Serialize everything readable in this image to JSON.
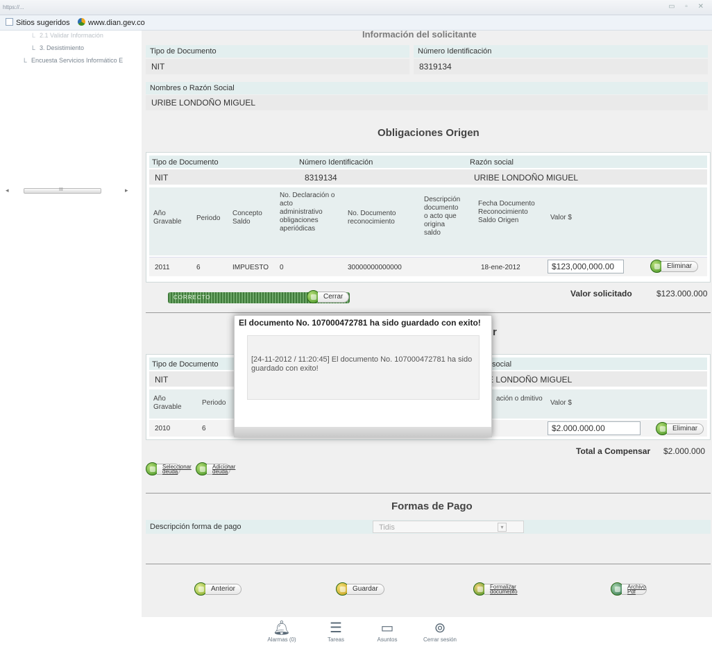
{
  "browser": {
    "url": "https://...",
    "window_buttons": "▭ ▫ ✕",
    "bookmarks": [
      {
        "label": "Sitios sugeridos"
      },
      {
        "label": "www.dian.gev.co"
      }
    ]
  },
  "tree": {
    "items": [
      {
        "label": "2.1 Validar Información"
      },
      {
        "label": "3. Desistimiento"
      },
      {
        "label": "Encuesta Servicios Informático E"
      }
    ],
    "scroll_grip": "III"
  },
  "solicitante": {
    "section_title": "Información del solicitante",
    "tipo_documento_label": "Tipo de Documento",
    "tipo_documento_value": "NIT",
    "numero_id_label": "Número Identificación",
    "numero_id_value": "8319134",
    "nombres_label": "Nombres o Razón Social",
    "nombres_value": "URIBE LONDOÑO MIGUEL"
  },
  "origen": {
    "section_title": "Obligaciones Origen",
    "tipo_documento_label": "Tipo de Documento",
    "numero_id_label": "Número Identificación",
    "razon_social_label": "Razón social",
    "tipo_documento_value": "NIT",
    "numero_id_value": "8319134",
    "razon_social_value": "URIBE LONDOÑO MIGUEL",
    "columns": [
      "Año Gravable",
      "Periodo",
      "Concepto Saldo",
      "No. Declaración o acto administrativo obligaciones aperiódicas",
      "No. Documento reconocimiento",
      "Descripción documento o acto que origina saldo",
      "Fecha Documento Reconocimiento Saldo Origen",
      "Valor $"
    ],
    "row": {
      "anio": "2011",
      "periodo": "6",
      "concepto": "IMPUESTO",
      "declaracion": "0",
      "documento": "30000000000000",
      "descripcion": "",
      "fecha": "18-ene-2012",
      "valor": "$123,000,000.00",
      "eliminar": "Eliminar"
    },
    "valor_solicitado_label": "Valor solicitado",
    "valor_solicitado_value": "$123.000.000"
  },
  "destino": {
    "section_title_partial": "r",
    "tipo_documento_label": "Tipo de Documento",
    "razon_social_label_partial": "social",
    "tipo_documento_value": "NIT",
    "razon_social_value_partial": "E LONDOÑO MIGUEL",
    "col_anio": "Año Gravable",
    "col_periodo": "Periodo",
    "col_declaracion_partial": "ación o dmitivo",
    "col_valor": "Valor $",
    "row": {
      "anio": "2010",
      "periodo": "6",
      "valor": "$2.000.000.00",
      "eliminar": "Eliminar"
    },
    "total_label": "Total a Compensar",
    "total_value": "$2.000.000",
    "btn_seleccionar": "Seleccionar deuda",
    "btn_adicionar": "Adicionar deuda"
  },
  "formas_pago": {
    "section_title": "Formas de Pago",
    "descripcion_label": "Descripción forma de pago",
    "select_value": "Tidis"
  },
  "actions": {
    "anterior": "Anterior",
    "guardar": "Guardar",
    "formalizar": "Formalizar documento",
    "archivo_pdf": "Archivo Pdf"
  },
  "modal": {
    "header_text": "CORRECTO",
    "close_label": "Cerrar",
    "title": "El documento No. 107000472781 ha sido guardado con exito!",
    "body": "[24-11-2012 / 11:20:45] El documento No. 107000472781 ha sido guardado con exito!"
  },
  "bottombar": {
    "items": [
      {
        "label": "Alarmas (0)",
        "icon": "bell-icon"
      },
      {
        "label": "Tareas",
        "icon": "tasks-icon"
      },
      {
        "label": "Asuntos",
        "icon": "folder-icon"
      },
      {
        "label": "Cerrar sesión",
        "icon": "logout-icon"
      }
    ]
  }
}
